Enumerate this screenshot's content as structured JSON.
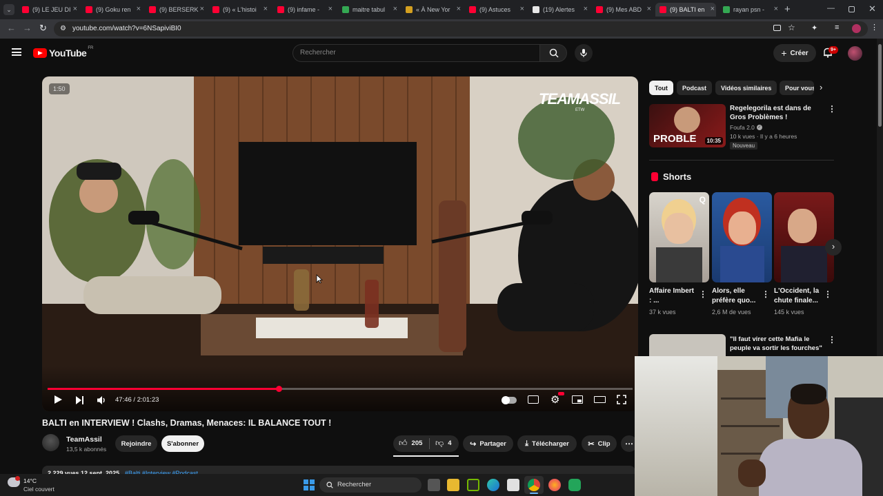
{
  "browser": {
    "tabs": [
      {
        "label": "(9) LE JEU DI"
      },
      {
        "label": "(9) Goku ren"
      },
      {
        "label": "(9) BERSERK"
      },
      {
        "label": "(9) « L'histoi"
      },
      {
        "label": "(9) infame -"
      },
      {
        "label": "maitre tabul"
      },
      {
        "label": "« À New Yor"
      },
      {
        "label": "(9) Astuces"
      },
      {
        "label": "(19) Alertes"
      },
      {
        "label": "(9) Mes ABD"
      },
      {
        "label": "(9) BALTI en"
      },
      {
        "label": "rayan psn -"
      }
    ],
    "new_tab": "+",
    "url": "youtube.com/watch?v=6NSapiviBI0"
  },
  "youtube": {
    "logo_text": "YouTube",
    "logo_region": "FR",
    "search_placeholder": "Rechercher",
    "create_label": "Créer",
    "notif_count": "9+"
  },
  "player": {
    "overlay_time": "1:50",
    "watermark": "TEAMASSIL",
    "watermark_sub": "ETW",
    "time": "47:46 / 2:01:23",
    "progress": 0.395
  },
  "video": {
    "title": "BALTI en INTERVIEW ! Clashs, Dramas, Menaces: IL BALANCE TOUT !",
    "channel": "TeamAssil",
    "subscribers": "13,5 k abonnés",
    "join_label": "Rejoindre",
    "subscribe_label": "S'abonner",
    "likes": "205",
    "dislikes": "4",
    "share_label": "Partager",
    "download_label": "Télécharger",
    "clip_label": "Clip",
    "desc_views": "2 229 vues  12 sept. 2025",
    "desc_tags": "#Balti #Interview #Podcast"
  },
  "sidebar": {
    "chips": [
      "Tout",
      "Podcast",
      "Vidéos similaires",
      "Pour vous"
    ],
    "rec1": {
      "title": "Regelegorila est dans de Gros Problèmes !",
      "channel": "Foufa 2.0",
      "meta": "10 k vues · Il y a 6 heures",
      "badge": "Nouveau",
      "duration": "10:35",
      "thumb_text": "PROBLE"
    },
    "shorts_title": "Shorts",
    "shorts": [
      {
        "title": "Affaire Imbert : ...",
        "views": "37 k vues"
      },
      {
        "title": "Alors, elle préfère quo...",
        "views": "2,6 M de vues"
      },
      {
        "title": "L'Occident, la chute finale...",
        "views": "145 k vues"
      }
    ],
    "rec2": {
      "title": "\"Il faut virer cette Mafia le peuple va sortir les fourches\""
    }
  },
  "taskbar": {
    "weather_temp": "14°C",
    "weather_desc": "Ciel couvert",
    "search_label": "Rechercher"
  }
}
